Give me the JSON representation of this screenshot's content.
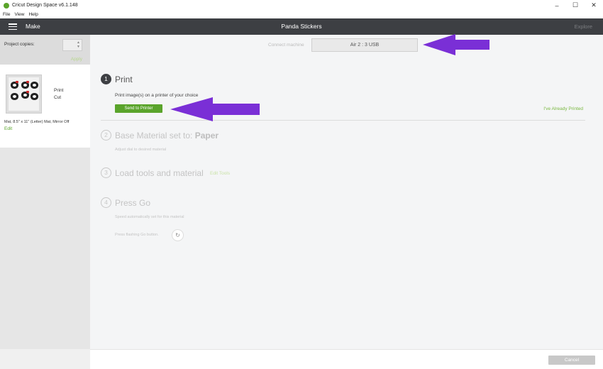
{
  "window": {
    "title": "Cricut Design Space  v6.1.148",
    "controls": [
      "–",
      "☐",
      "✕"
    ]
  },
  "menu": [
    "File",
    "View",
    "Help"
  ],
  "header": {
    "make_label": "Make",
    "project_title": "Panda Stickers",
    "explore_label": "Explore"
  },
  "sidebar": {
    "copies_label": "Project copies:",
    "copies_value": "",
    "apply_label": "Apply",
    "mat": {
      "print_label": "Print",
      "cut_label": "Cut",
      "info": "Mat, 8.5\" x 11\" (Letter) Mat, Mirror Off",
      "edit_label": "Edit"
    }
  },
  "machine": {
    "connect_label": "Connect machine",
    "selected": "Air 2 : 3 USB"
  },
  "steps": [
    {
      "number": "1",
      "title": "Print",
      "description": "Print image(s) on a printer of your choice",
      "button": "Send to Printer",
      "alt_link": "I've Already Printed"
    },
    {
      "number": "2",
      "title": "Base Material set to:",
      "material": "Paper",
      "description": "Adjust dial to desired material"
    },
    {
      "number": "3",
      "title": "Load tools and material",
      "link": "Edit Tools"
    },
    {
      "number": "4",
      "title": "Press Go",
      "description": "Speed automatically set for this material",
      "go_label": "Press flashing Go button."
    }
  ],
  "footer": {
    "cancel_label": "Cancel"
  },
  "colors": {
    "header": "#3d3f43",
    "accent_green": "#5aa42b",
    "annotation_arrow": "#7a2fd6"
  }
}
